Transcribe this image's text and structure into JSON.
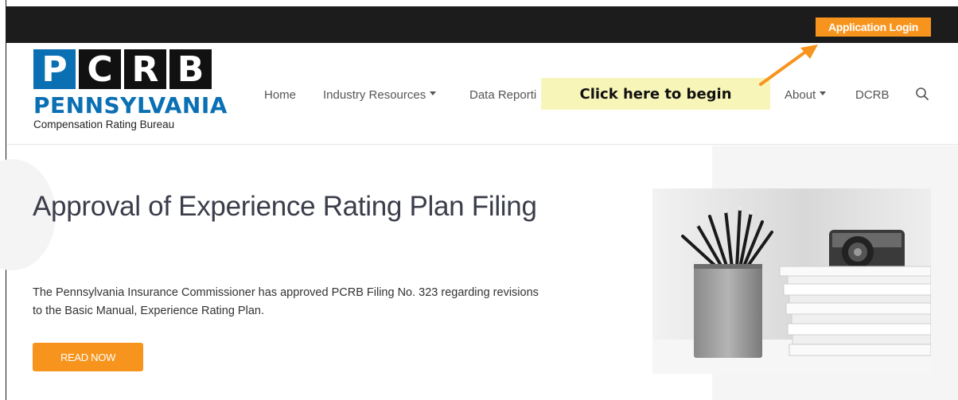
{
  "topbar": {
    "login_label": "Application Login"
  },
  "logo": {
    "letters": [
      "P",
      "C",
      "R",
      "B"
    ],
    "state": "PENNSYLVANIA",
    "subtitle": "Compensation Rating Bureau"
  },
  "nav": {
    "items": [
      {
        "label": "Home",
        "has_caret": false
      },
      {
        "label": "Industry Resources",
        "has_caret": true
      },
      {
        "label": "Data Reporti",
        "has_caret": false
      },
      {
        "label": "About",
        "has_caret": true
      },
      {
        "label": "DCRB",
        "has_caret": false
      }
    ],
    "search_icon": "search-icon"
  },
  "callout": {
    "text": "Click here to begin"
  },
  "hero": {
    "title": "Approval of Experience Rating Plan Filing",
    "description": "The Pennsylvania Insurance Commissioner has approved PCRB Filing No. 323 regarding revisions to the Basic Manual, Experience Rating Plan.",
    "button_label": "READ NOW"
  },
  "colors": {
    "accent_orange": "#f7941d",
    "brand_blue": "#0a6fb3",
    "topbar": "#1c1c1c",
    "callout_bg": "#f8f5b8"
  }
}
